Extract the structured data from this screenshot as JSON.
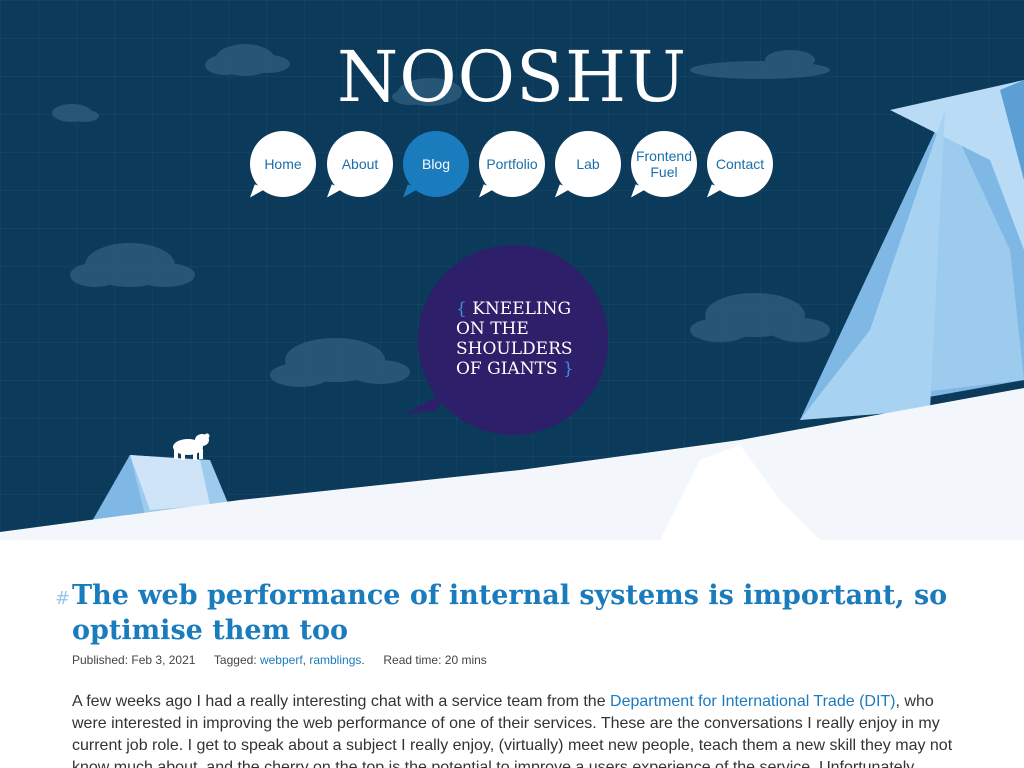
{
  "site": {
    "logo": "NOOSHU"
  },
  "nav": {
    "items": [
      {
        "label": "Home",
        "active": false
      },
      {
        "label": "About",
        "active": false
      },
      {
        "label": "Blog",
        "active": true
      },
      {
        "label": "Portfolio",
        "active": false
      },
      {
        "label": "Lab",
        "active": false
      },
      {
        "label": "Frontend Fuel",
        "active": false
      },
      {
        "label": "Contact",
        "active": false
      }
    ]
  },
  "tagline": {
    "open_brace": "{",
    "text": "KNEELING ON THE SHOULDERS OF GIANTS",
    "close_brace": "}"
  },
  "post": {
    "hash": "#",
    "title": "The web performance of internal systems is important, so optimise them too",
    "published_label": "Published:",
    "published_date": "Feb 3, 2021",
    "tagged_label": "Tagged:",
    "tags": [
      "webperf",
      "ramblings"
    ],
    "read_time_label": "Read time:",
    "read_time": "20 mins",
    "intro_before_link": "A few weeks ago I had a really interesting chat with a service team from the ",
    "intro_link": "Department for International Trade (DIT)",
    "intro_after_link": ", who were interested in improving the web performance of one of their services. These are the conversations I really enjoy in my current job role. I get to speak about a subject I really enjoy, (virtually) meet new people, teach them a new skill they may not know much about, and the cherry on the top is the potential to improve a users experience of the service. Unfortunately"
  },
  "colors": {
    "sky": "#0b3a5a",
    "accent": "#1a7bbd",
    "tagline_bubble": "#2e1f6b"
  }
}
